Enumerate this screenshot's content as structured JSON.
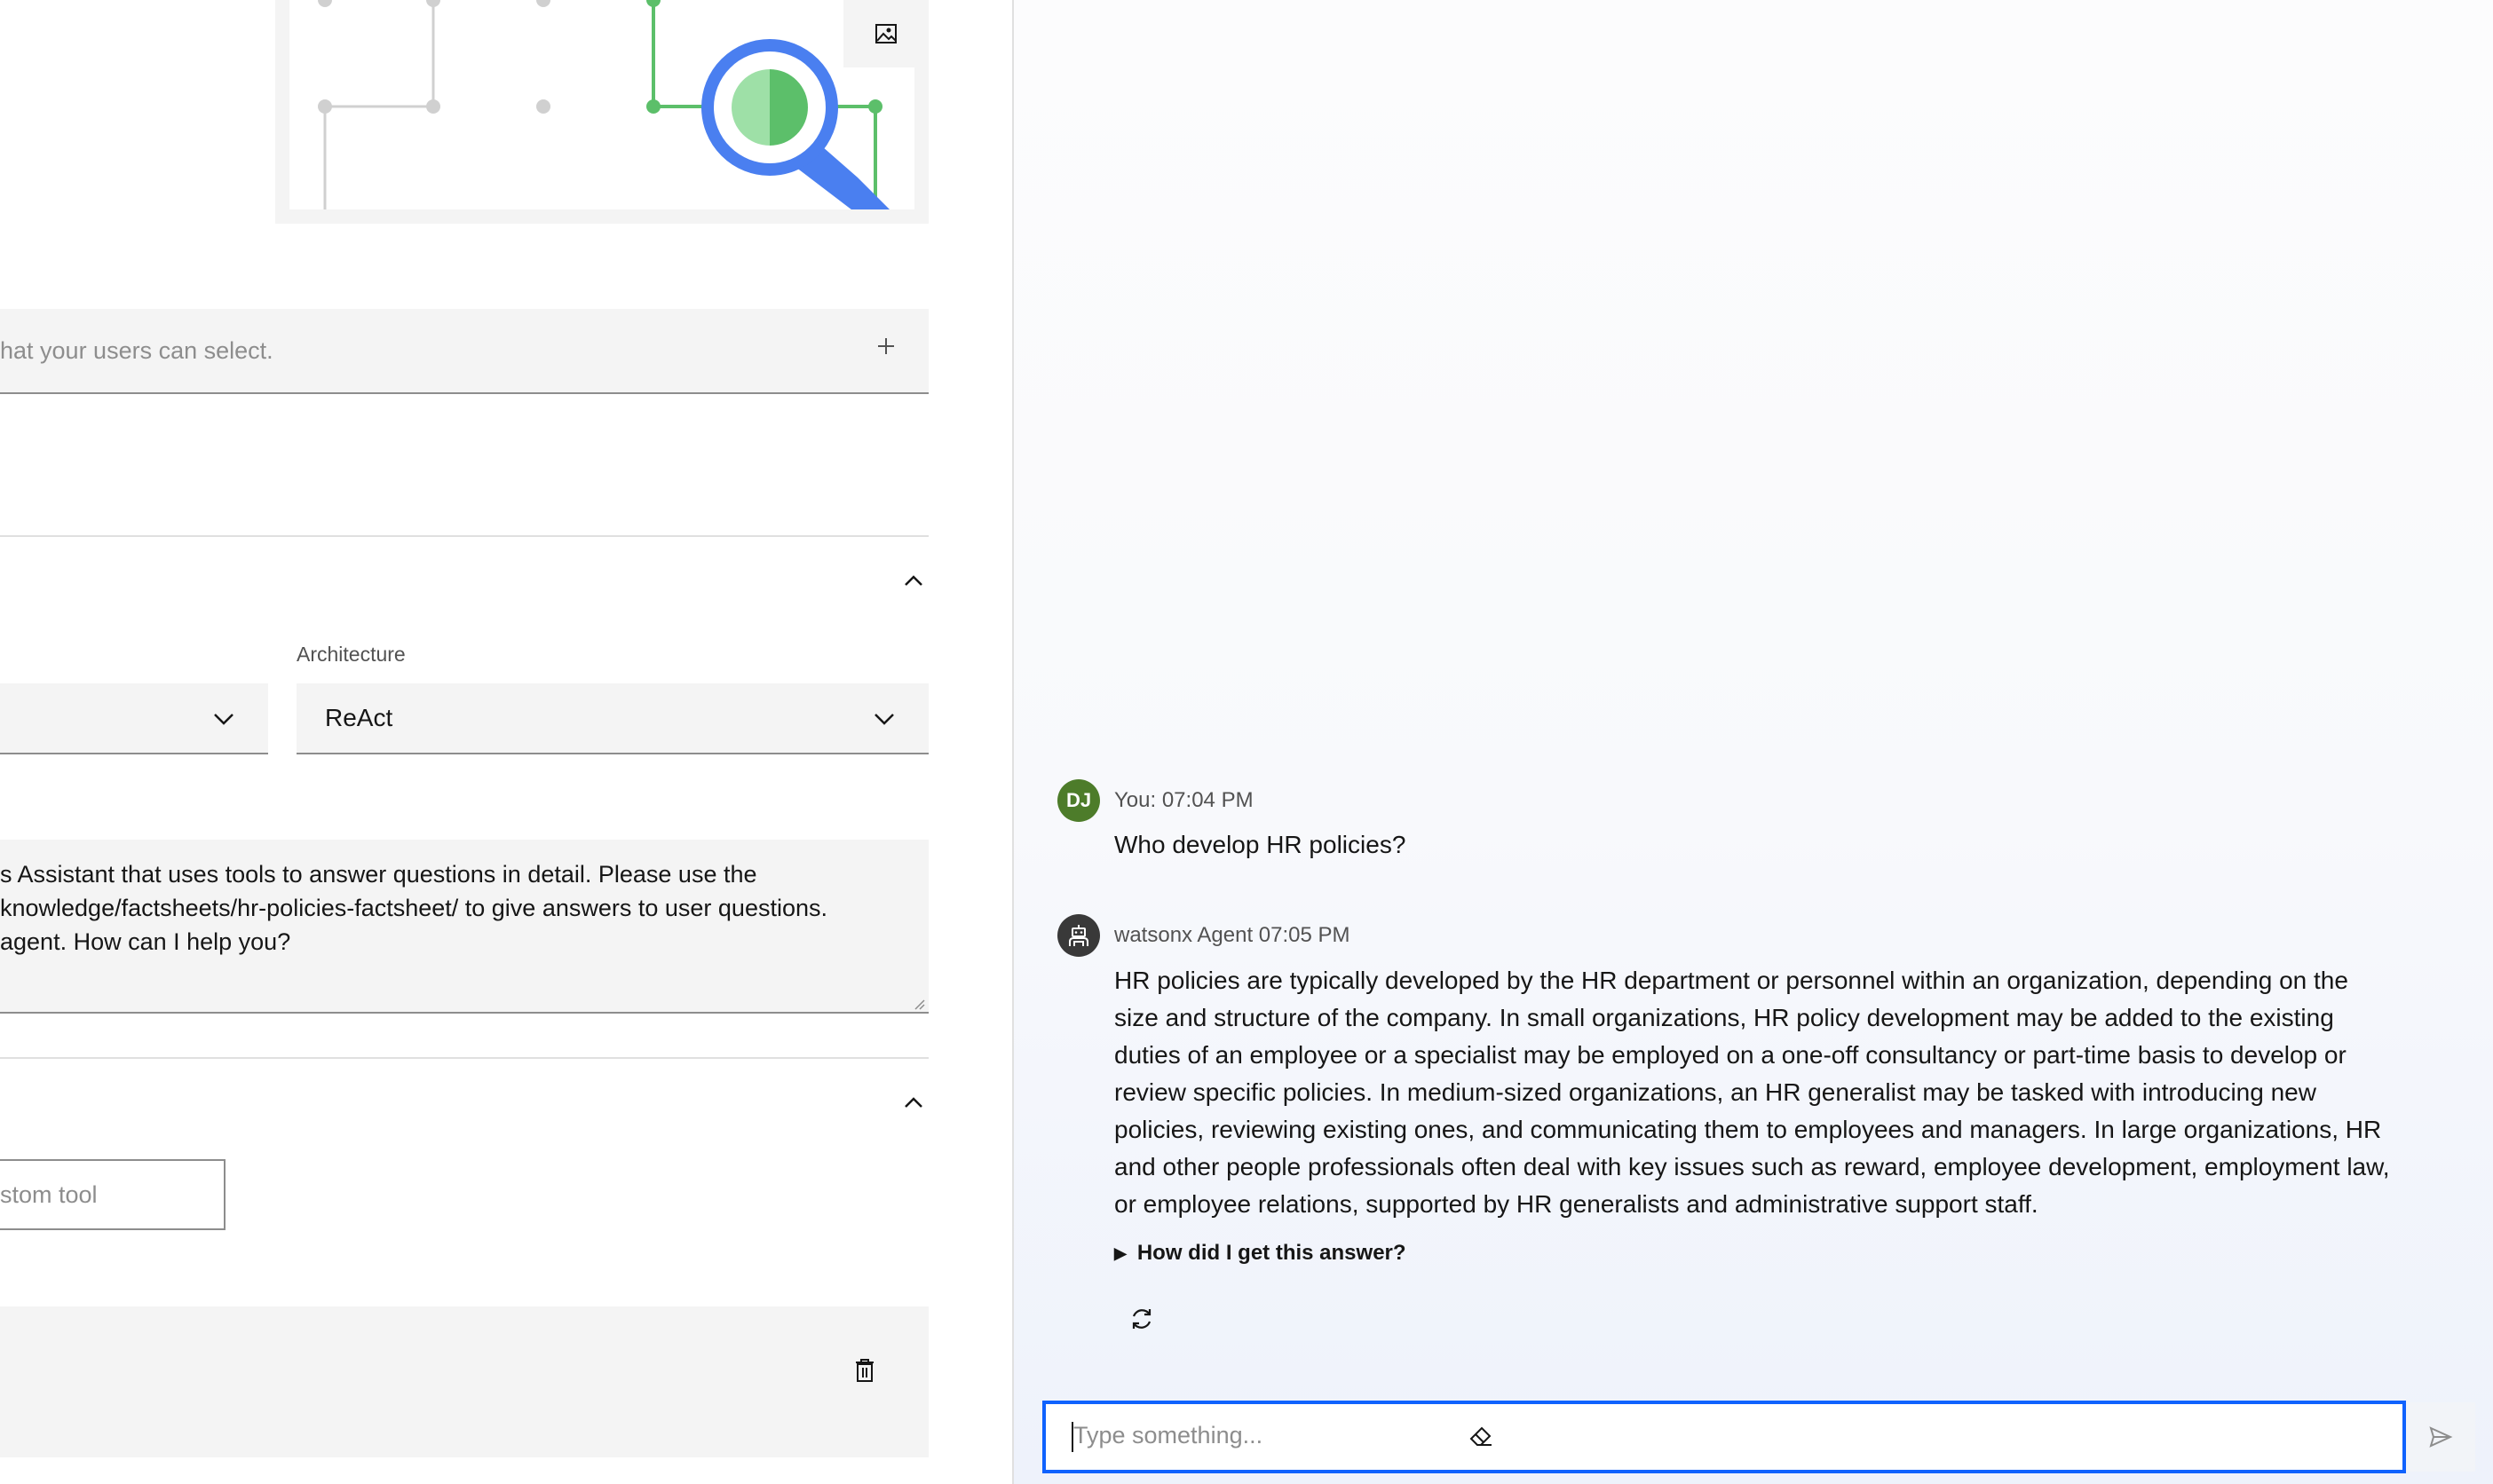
{
  "builder": {
    "options_placeholder": "hat your users can select.",
    "options_add_icon": "plus-icon",
    "architecture_label": "Architecture",
    "architecture_value": "ReAct",
    "instructions_lines": [
      "s Assistant that uses tools to answer questions in detail. Please use the",
      "knowledge/factsheets/hr-policies-factsheet/ to give answers to user questions.",
      " agent. How can I help you?"
    ],
    "custom_tool_placeholder": "stom tool"
  },
  "chat": {
    "user_avatar": "DJ",
    "user_meta": "You: 07:04 PM",
    "user_message": "Who develop HR policies?",
    "agent_meta": "watsonx Agent 07:05 PM",
    "agent_message": "HR policies are typically developed by the HR department or personnel within an organization, depending on the size and structure of the company. In small organizations, HR policy development may be added to the existing duties of an employee or a specialist may be employed on a one-off consultancy or part-time basis to develop or review specific policies. In medium-sized organizations, an HR generalist may be tasked with introducing new policies, reviewing existing ones, and communicating them to employees and managers. In large organizations, HR and other people professionals often deal with key issues such as reward, employee development, employment law, or employee relations, supported by HR generalists and administrative support staff.",
    "explain_toggle": "How did I get this answer?",
    "input_placeholder": "Type something..."
  },
  "colors": {
    "accent": "#0f62fe",
    "user_avatar_bg": "#4d7c2a",
    "agent_avatar_bg": "#393939",
    "illustration_green": "#5cbf6a",
    "illustration_blue": "#4a7ff0"
  }
}
